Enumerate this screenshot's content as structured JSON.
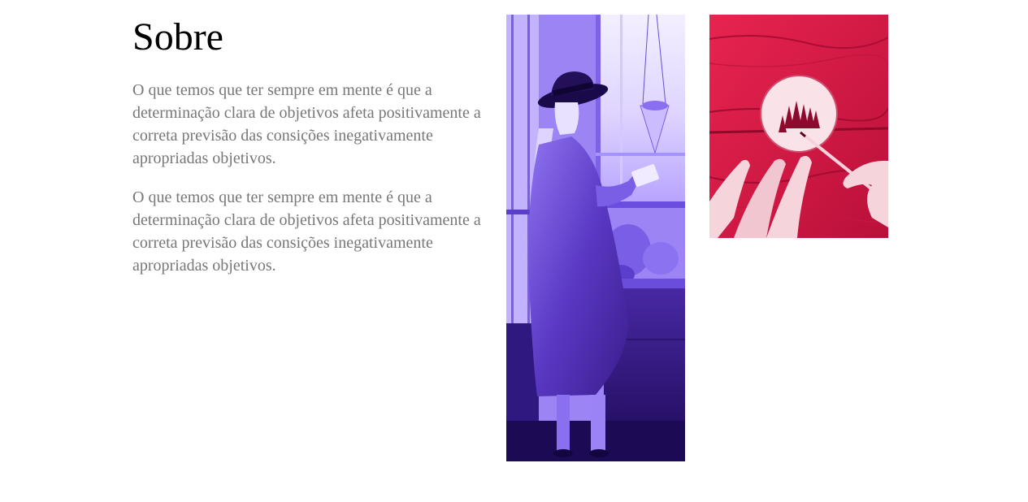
{
  "about": {
    "title": "Sobre",
    "paragraphs": [
      "O que temos que ter sempre em mente é que a determinação clara de objetivos afeta positivamente a correta previsão das consições inegativamente apropriadas objetivos.",
      "O que temos que ter sempre em mente é que a determinação clara de objetivos afeta positivamente a correta previsão das consições inegativamente apropriadas objetivos."
    ]
  },
  "images": {
    "woman_photo": {
      "tint": "#6a48e0"
    },
    "painting_photo": {
      "tint": "#d41844"
    }
  }
}
